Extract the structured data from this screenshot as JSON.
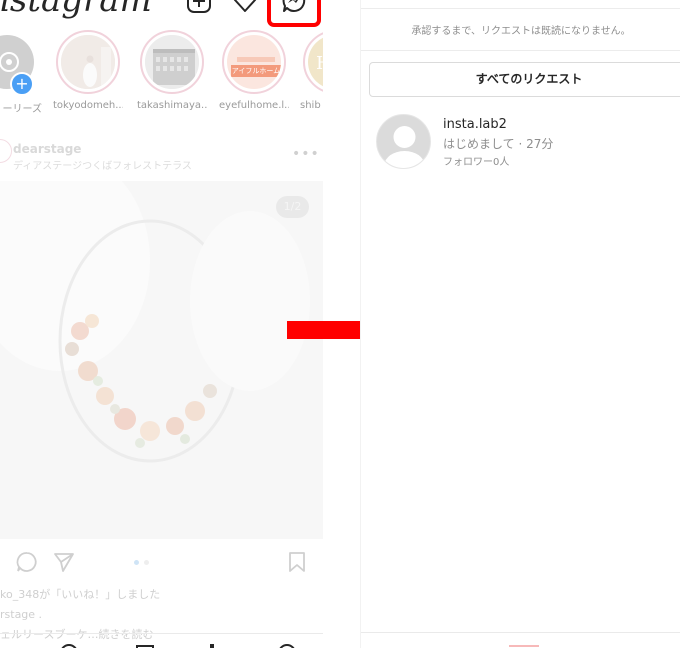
{
  "left": {
    "logo": "nstagram",
    "stories": [
      {
        "label": "ーリーズ"
      },
      {
        "label": "tokyodomeh..."
      },
      {
        "label": "takashimaya..."
      },
      {
        "label": "eyefulhome.l...",
        "brand": "アイフルホーム"
      },
      {
        "label": "shib"
      }
    ],
    "post": {
      "username": "dearstage",
      "location": "ディアステージつくばフォレストテラス",
      "counter": "1/2",
      "liked_by": "ko_348が「いいね！」しました",
      "caption_user": "rstage .",
      "caption_text": "ェルリースブーケ…続きを読む"
    }
  },
  "right": {
    "notice": "承認するまで、リクエストは既読になりません。",
    "all_requests_button": "すべてのリクエスト",
    "request": {
      "username": "insta.lab2",
      "message": "はじめまして · 27分",
      "followers": "フォロワー0人"
    }
  },
  "colors": {
    "highlight": "#ff0000",
    "arrow": "#ff0000",
    "story_ring": "#f1d2db"
  }
}
